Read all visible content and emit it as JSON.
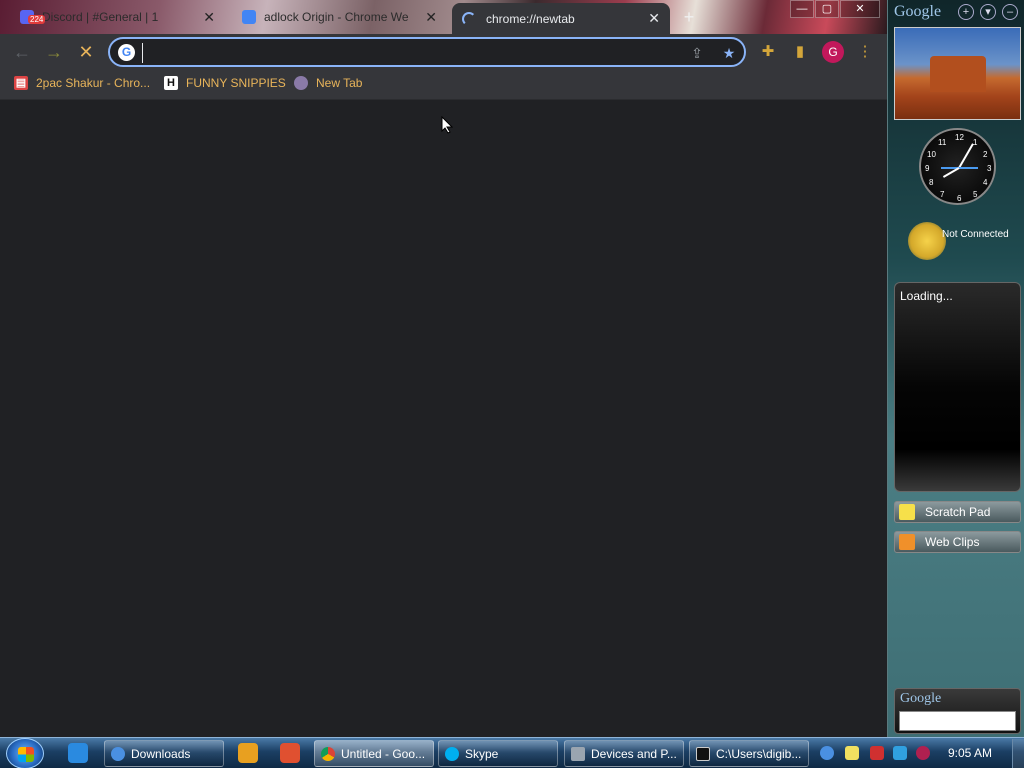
{
  "tabs": [
    {
      "title": "Discord | #General | 1",
      "badge": "224",
      "favicon_color": "#5865f2",
      "active": false
    },
    {
      "title": "adlock Origin - Chrome We",
      "favicon_color": "#4285f4",
      "active": false
    },
    {
      "title": "chrome://newtab",
      "active": true
    }
  ],
  "window_controls": {
    "minimize": "—",
    "maximize": "▢",
    "close": "✕"
  },
  "omnibox": {
    "value": "",
    "placeholder": ""
  },
  "bookmarks": [
    {
      "label": "2pac Shakur - Chro...",
      "icon": "store-icon"
    },
    {
      "label": "FUNNY SNIPPIES",
      "icon": "H"
    },
    {
      "label": "New Tab",
      "icon": "globe-icon"
    }
  ],
  "profile": {
    "initial": "G"
  },
  "sidebar": {
    "logo": "Google",
    "weather_status": "Not Connected",
    "loading_text": "Loading...",
    "gadgets": [
      {
        "label": "Scratch Pad"
      },
      {
        "label": "Web Clips"
      }
    ],
    "search_label": "Google",
    "clock_numbers": [
      "12",
      "1",
      "2",
      "3",
      "4",
      "5",
      "6",
      "7",
      "8",
      "9",
      "10",
      "11"
    ]
  },
  "taskbar": {
    "items": [
      {
        "label": "Downloads",
        "active": false
      },
      {
        "label": "Untitled - Goo...",
        "active": true
      },
      {
        "label": "Skype",
        "active": false
      },
      {
        "label": "Devices and P...",
        "active": false
      },
      {
        "label": "C:\\Users\\digib...",
        "active": false
      }
    ],
    "time": "9:05 AM"
  },
  "colors": {
    "accent": "#8ab4f8",
    "bookmark_text": "#e8b45a",
    "content_bg": "#202124"
  }
}
